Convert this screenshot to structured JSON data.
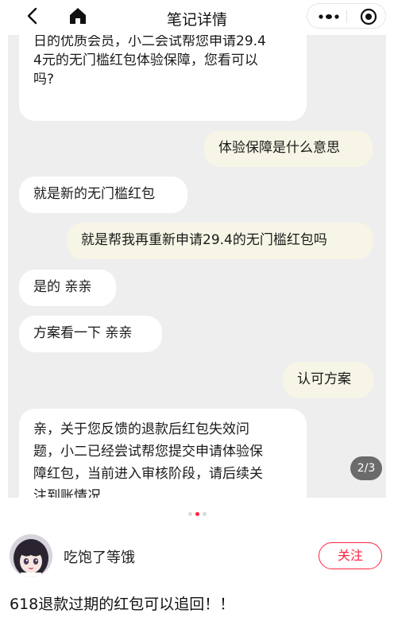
{
  "nav": {
    "title": "笔记详情",
    "back_icon": "chevron-left-icon",
    "home_icon": "home-icon",
    "more_icon": "more-dots-icon",
    "target_icon": "target-icon"
  },
  "chat": {
    "messages": [
      {
        "side": "left",
        "lines": [
          "日的优质会员，小二会试帮您申请29.4",
          "4元的无门槛红包体验保障，您看可以",
          "吗?"
        ]
      },
      {
        "side": "right",
        "lines": [
          "体验保障是什么意思"
        ]
      },
      {
        "side": "left",
        "lines": [
          "就是新的无门槛红包"
        ]
      },
      {
        "side": "right",
        "lines": [
          "就是帮我再重新申请29.4的无门槛红包吗"
        ]
      },
      {
        "side": "left",
        "lines": [
          "是的 亲亲"
        ]
      },
      {
        "side": "left",
        "lines": [
          "方案看一下 亲亲"
        ]
      },
      {
        "side": "right",
        "lines": [
          "认可方案"
        ]
      },
      {
        "side": "left",
        "lines": [
          "亲，关于您反馈的退款后红包失效问",
          "题，小二已经尝试帮您提交申请体验保",
          "障红包，当前进入审核阶段，请后续关",
          "注到账情况"
        ]
      }
    ],
    "pager": "2/3"
  },
  "carousel": {
    "count": 3,
    "active": 1
  },
  "author": {
    "name": "吃饱了等饿",
    "follow_label": "关注"
  },
  "note": {
    "title": "618退款过期的红包可以追回！！"
  },
  "colors": {
    "accent": "#ff2442",
    "chat_bg": "#eeeeef",
    "right_bubble": "#f7f5e6"
  }
}
